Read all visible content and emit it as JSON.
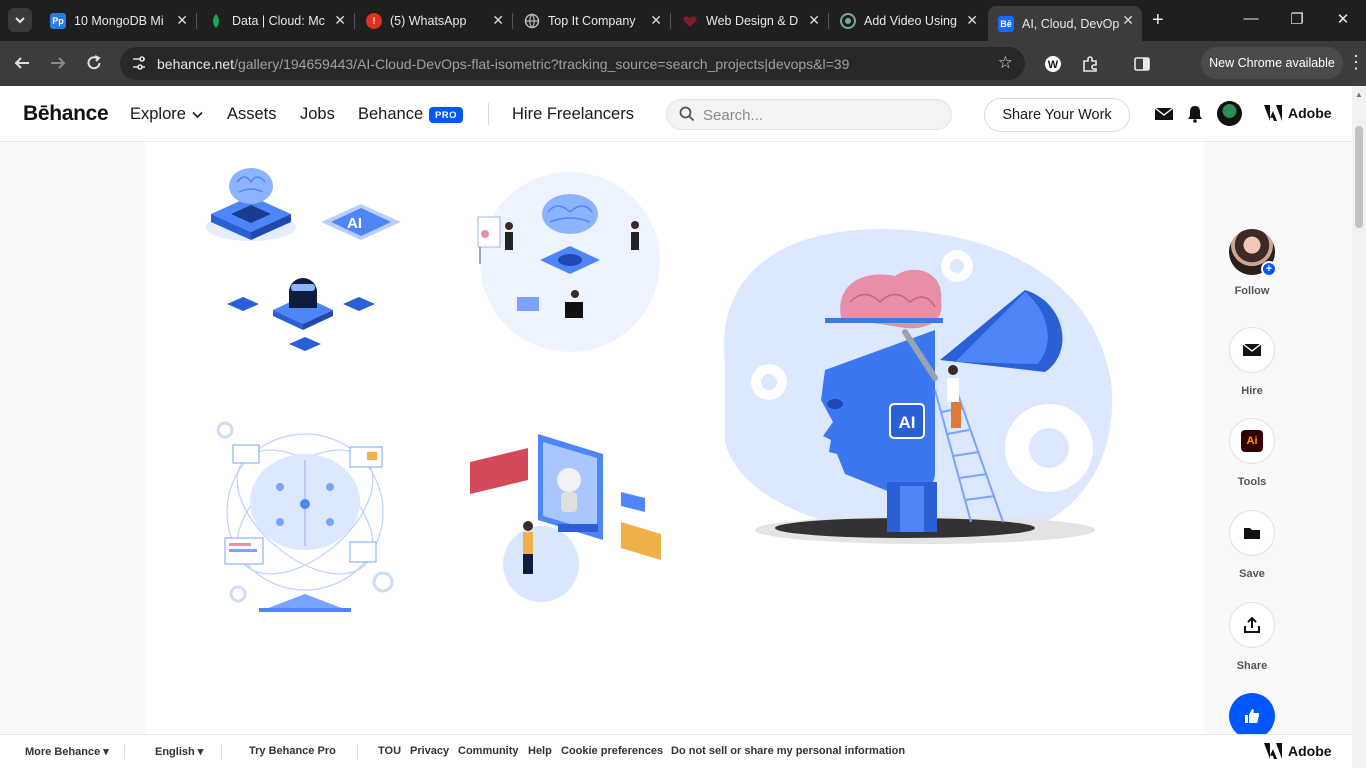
{
  "browser": {
    "tabs": [
      {
        "title": "10 MongoDB Mi",
        "favicon": "premiere-pro-icon",
        "favicon_color": "#2c7be5",
        "favicon_text": "Pp"
      },
      {
        "title": "Data | Cloud: Mc",
        "favicon": "mongodb-leaf-icon",
        "favicon_color": "#13aa52"
      },
      {
        "title": "(5) WhatsApp",
        "favicon": "whatsapp-alert-icon",
        "favicon_color": "#e0301e",
        "favicon_text": "!"
      },
      {
        "title": "Top It Company",
        "favicon": "globe-icon",
        "favicon_color": "#8a8a8a"
      },
      {
        "title": "Web Design & D",
        "favicon": "heart-icon",
        "favicon_color": "#7a1f2b"
      },
      {
        "title": "Add Video Using",
        "favicon": "chatgpt-icon",
        "favicon_color": "#74aa9c"
      },
      {
        "title": "AI, Cloud, DevOp",
        "favicon": "behance-icon",
        "favicon_color": "#1769ff",
        "favicon_text": "Bē"
      }
    ],
    "url": {
      "host": "behance.net",
      "path": "/gallery/194659443/AI-Cloud-DevOps-flat-isometric?tracking_source=search_projects|devops&l=39"
    },
    "extension_badge": "0",
    "update_button": "New Chrome available"
  },
  "header": {
    "logo": "Bēhance",
    "nav": {
      "explore": "Explore",
      "assets": "Assets",
      "jobs": "Jobs",
      "behance": "Behance",
      "pro_badge": "PRO",
      "hire": "Hire Freelancers"
    },
    "search_placeholder": "Search...",
    "share_button": "Share Your Work",
    "adobe": "Adobe"
  },
  "artwork": {
    "ai_label": "AI",
    "chip_label": "AI"
  },
  "rail": {
    "follow": "Follow",
    "hire": "Hire",
    "tools": "Tools",
    "tools_icon_text": "Ai",
    "save": "Save",
    "share": "Share"
  },
  "footer": {
    "more_behance": "More Behance",
    "language": "English",
    "try_pro": "Try Behance Pro",
    "links": [
      "TOU",
      "Privacy",
      "Community",
      "Help",
      "Cookie preferences",
      "Do not sell or share my personal information"
    ],
    "adobe": "Adobe"
  },
  "colors": {
    "behance_blue": "#0057ff",
    "art_blue": "#3b82f6",
    "art_pink": "#e88fa8",
    "chrome_dark": "#1f1f1f"
  }
}
